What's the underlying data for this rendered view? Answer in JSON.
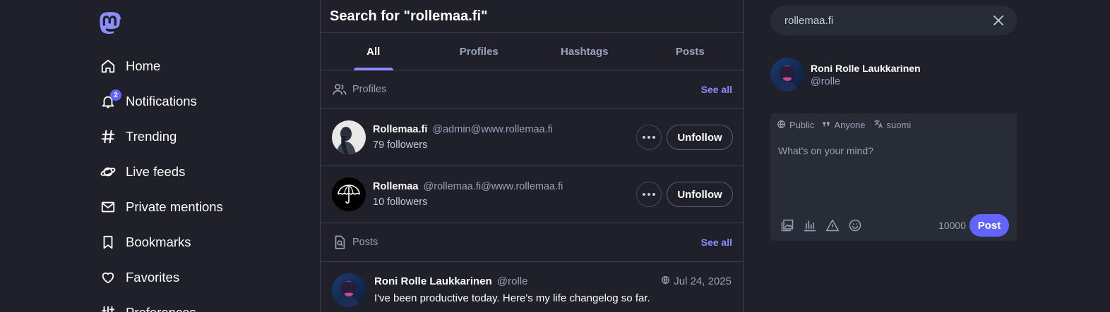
{
  "colors": {
    "background": "#1f2029",
    "accent": "#6364ff",
    "accent_light": "#8c8dff",
    "border": "#393f4f",
    "muted": "#9aa1b8"
  },
  "sidebar": {
    "logo": "mastodon-logo",
    "items": [
      {
        "label": "Home",
        "icon": "home-icon"
      },
      {
        "label": "Notifications",
        "icon": "bell-icon",
        "badge": "2"
      },
      {
        "label": "Trending",
        "icon": "hashtag-icon"
      },
      {
        "label": "Live feeds",
        "icon": "planet-icon"
      },
      {
        "label": "Private mentions",
        "icon": "mail-icon"
      },
      {
        "label": "Bookmarks",
        "icon": "bookmark-icon"
      },
      {
        "label": "Favorites",
        "icon": "heart-icon"
      },
      {
        "label": "Preferences",
        "icon": "sliders-icon"
      }
    ]
  },
  "search_results": {
    "title": "Search for \"rollemaa.fi\"",
    "tabs": [
      "All",
      "Profiles",
      "Hashtags",
      "Posts"
    ],
    "active_tab": "All",
    "profiles_section": {
      "label": "Profiles",
      "see_all": "See all"
    },
    "accounts": [
      {
        "display_name": "Rollemaa.fi",
        "handle": "@admin@www.rollemaa.fi",
        "followers": "79 followers",
        "action": "Unfollow"
      },
      {
        "display_name": "Rollemaa",
        "handle": "@rollemaa.fi@www.rollemaa.fi",
        "followers": "10 followers",
        "action": "Unfollow"
      }
    ],
    "posts_section": {
      "label": "Posts",
      "see_all": "See all"
    },
    "posts": [
      {
        "author": "Roni Rolle Laukkarinen",
        "handle": "@rolle",
        "date": "Jul 24, 2025",
        "visibility": "public-globe-icon",
        "text": "I've been productive today. Here's my life changelog so far."
      }
    ]
  },
  "right_panel": {
    "search": {
      "value": "rollemaa.fi"
    },
    "current_user": {
      "name": "Roni Rolle Laukkarinen",
      "handle": "@rolle"
    },
    "composer": {
      "visibility": "Public",
      "quote_policy": "Anyone",
      "language": "suomi",
      "placeholder": "What's on your mind?",
      "char_count": "10000",
      "post_label": "Post"
    }
  }
}
